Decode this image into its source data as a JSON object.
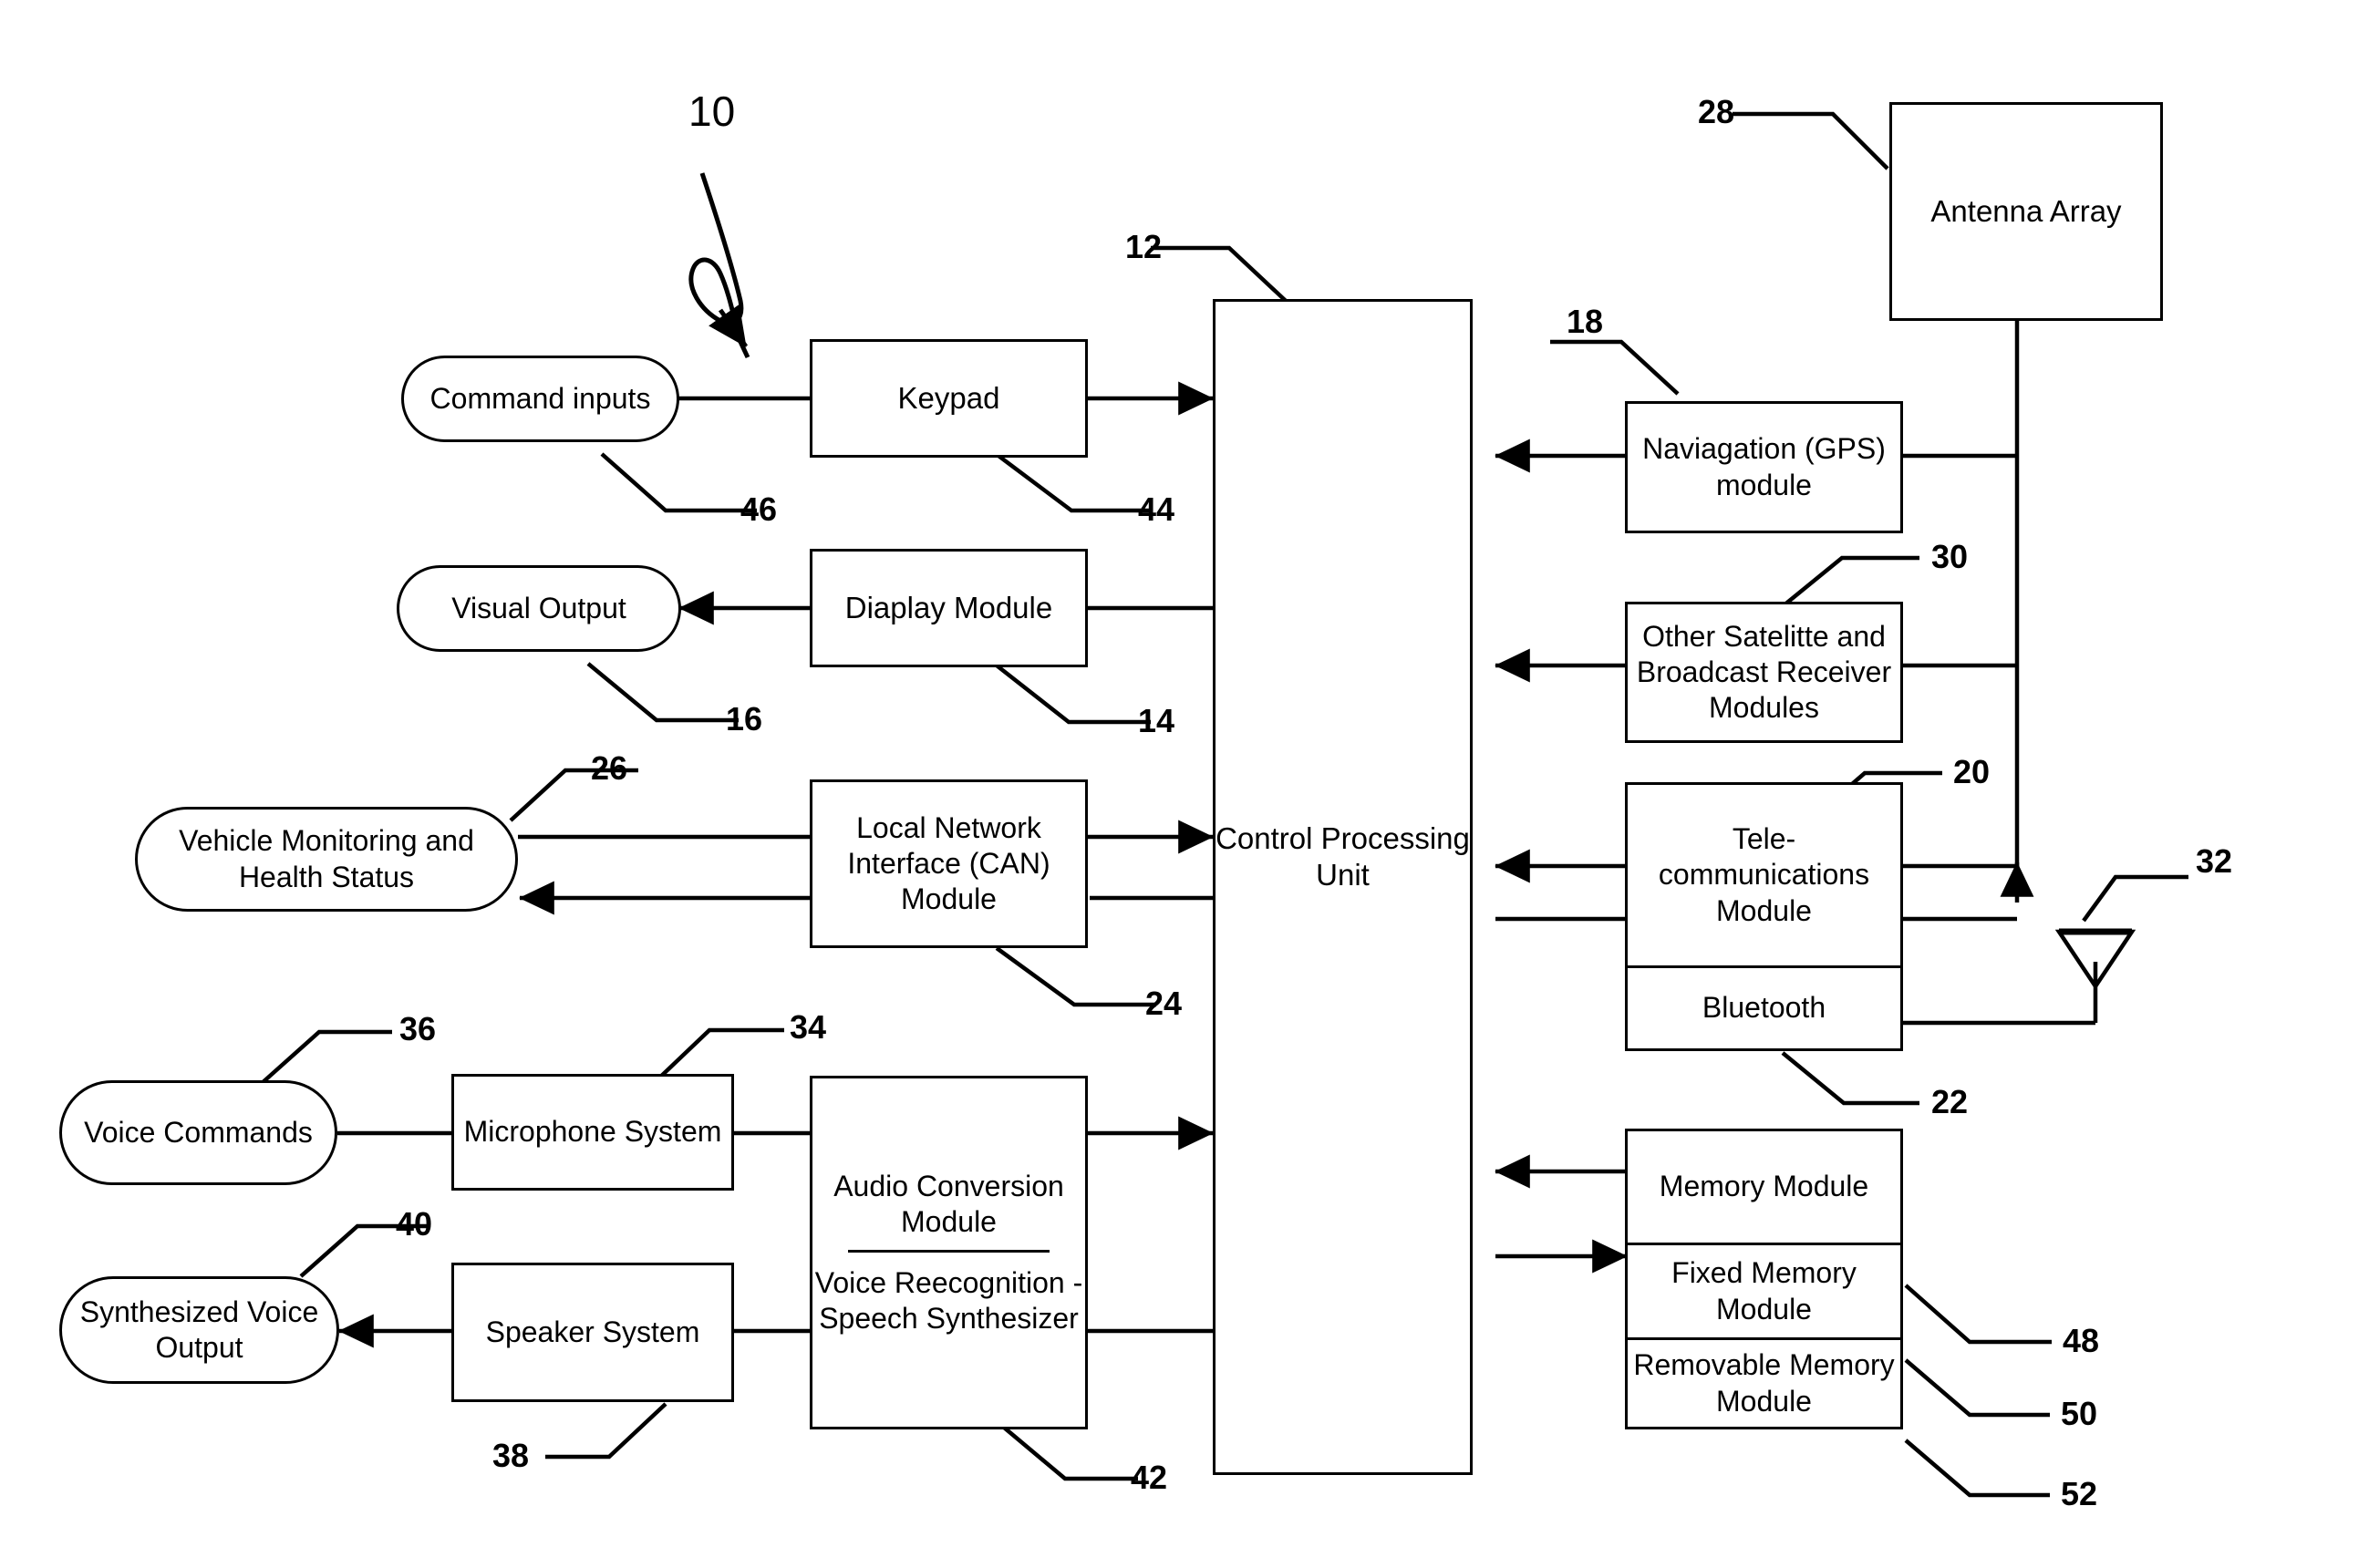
{
  "figure": {
    "label": "10",
    "reference_numerals": [
      "10",
      "12",
      "14",
      "16",
      "18",
      "20",
      "22",
      "24",
      "26",
      "28",
      "30",
      "32",
      "34",
      "36",
      "38",
      "40",
      "42",
      "44",
      "46",
      "48",
      "50",
      "52"
    ]
  },
  "nodes": {
    "command_inputs": {
      "label": "Command inputs",
      "ref": "46",
      "shape": "pill"
    },
    "keypad": {
      "label": "Keypad",
      "ref": "44",
      "shape": "rect"
    },
    "visual_output": {
      "label": "Visual Output",
      "ref": "16",
      "shape": "pill"
    },
    "display_module": {
      "label": "Diaplay Module",
      "ref": "14",
      "shape": "rect"
    },
    "vehicle_status": {
      "label": "Vehicle Monitoring and Health Status",
      "ref": "26",
      "shape": "pill"
    },
    "can_module": {
      "label": "Local Network Interface (CAN) Module",
      "ref": "24",
      "shape": "rect"
    },
    "voice_commands": {
      "label": "Voice Commands",
      "ref": "36",
      "shape": "pill"
    },
    "microphone_system": {
      "label": "Microphone System",
      "ref": "34",
      "shape": "rect"
    },
    "synthesized_voice": {
      "label": "Synthesized Voice Output",
      "ref": "40",
      "shape": "pill"
    },
    "speaker_system": {
      "label": "Speaker System",
      "ref": "38",
      "shape": "rect"
    },
    "audio_conversion": {
      "label_top": "Audio Conversion Module",
      "label_bottom": "Voice Reecognition - Speech Synthesizer",
      "ref": "42",
      "shape": "split"
    },
    "cpu": {
      "label": "Control Processing Unit",
      "ref": "12",
      "shape": "rect"
    },
    "antenna_array": {
      "label": "Antenna Array",
      "ref": "28",
      "shape": "rect"
    },
    "gps_module": {
      "label": "Naviagation (GPS) module",
      "ref": "18",
      "shape": "rect"
    },
    "satellite_receivers": {
      "label": "Other Satelitte and Broadcast Receiver Modules",
      "ref": "30",
      "shape": "rect"
    },
    "telecom_module": {
      "label": "Tele-communications Module",
      "ref": "20",
      "shape": "rect"
    },
    "bluetooth_module": {
      "label": "Bluetooth",
      "ref": "22",
      "shape": "rect"
    },
    "memory_module": {
      "label": "Memory Module",
      "ref": "48",
      "shape": "rect"
    },
    "fixed_memory": {
      "label": "Fixed Memory Module",
      "ref": "50",
      "shape": "rect"
    },
    "removable_memory": {
      "label": "Removable Memory Module",
      "ref": "52",
      "shape": "rect"
    },
    "bluetooth_antenna": {
      "label": "",
      "ref": "32",
      "shape": "antenna-symbol"
    }
  },
  "colors": {
    "line": "#000000",
    "fill": "#ffffff",
    "text": "#000000"
  }
}
